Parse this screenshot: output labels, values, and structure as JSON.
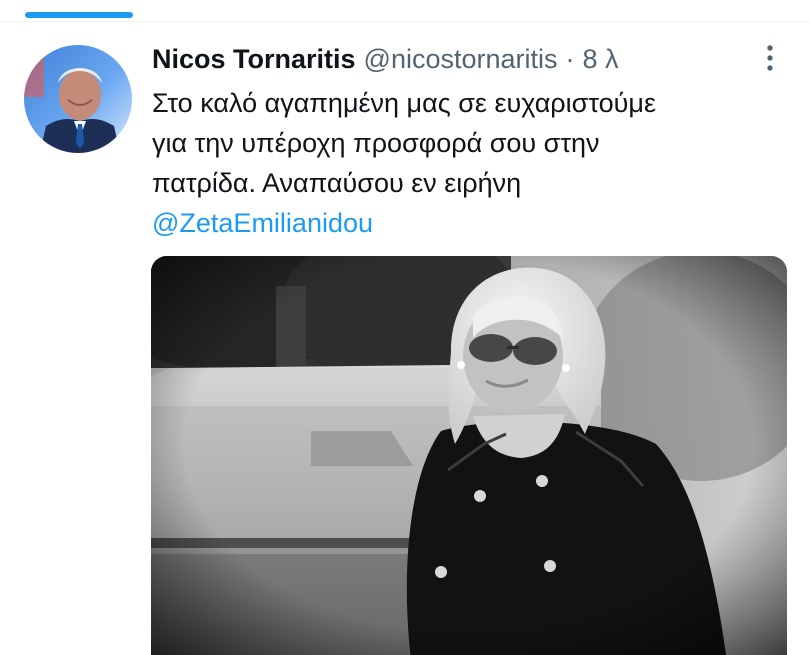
{
  "colors": {
    "accent": "#1d9bf0",
    "text_primary": "#0f1419",
    "text_secondary": "#536471"
  },
  "tweet": {
    "author": {
      "display_name": "Nicos Tornaritis",
      "handle": "@nicostornaritis",
      "separator": "·",
      "timestamp": "8 λ"
    },
    "text_lines": [
      "Στο καλό αγαπημένη μας σε ευχαριστούμε",
      "για την υπέροχη προσφορά σου στην",
      "πατρίδα. Αναπαύσου εν ειρήνη"
    ],
    "mention": "@ZetaEmilianidou",
    "icons": {
      "more": "more-vertical-icon",
      "avatar": "avatar-photo"
    }
  }
}
